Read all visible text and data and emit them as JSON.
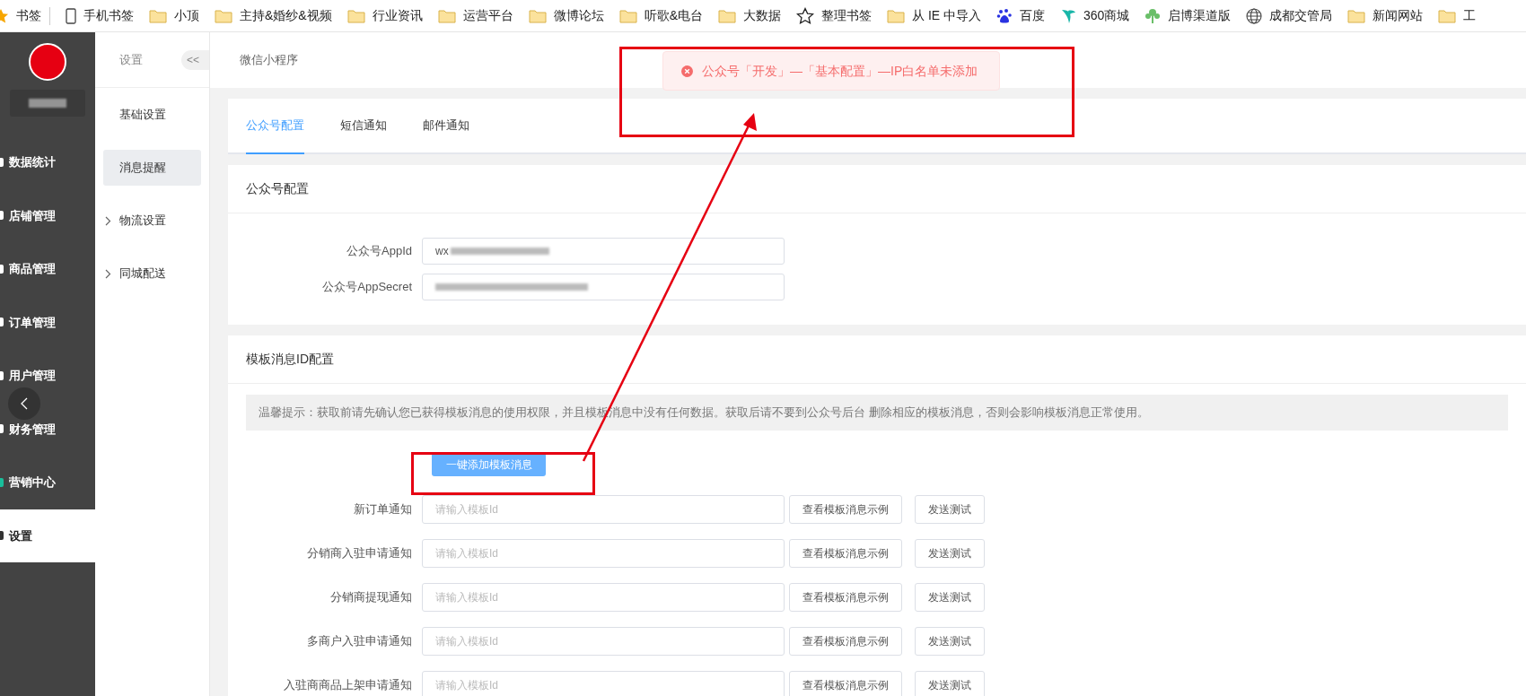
{
  "bookmarks": [
    {
      "kind": "star",
      "label": "书签"
    },
    {
      "kind": "phone",
      "label": "手机书签"
    },
    {
      "kind": "folder",
      "label": "小顶"
    },
    {
      "kind": "folder",
      "label": "主持&婚纱&视频"
    },
    {
      "kind": "folder",
      "label": "行业资讯"
    },
    {
      "kind": "folder",
      "label": "运营平台"
    },
    {
      "kind": "folder",
      "label": "微博论坛"
    },
    {
      "kind": "folder",
      "label": "听歌&电台"
    },
    {
      "kind": "folder",
      "label": "大数据"
    },
    {
      "kind": "manage",
      "label": "整理书签"
    },
    {
      "kind": "folder",
      "label": "从 IE 中导入"
    },
    {
      "kind": "paw",
      "label": "百度"
    },
    {
      "kind": "leaf",
      "label": "360商城"
    },
    {
      "kind": "tree",
      "label": "启博渠道版"
    },
    {
      "kind": "globe",
      "label": "成都交管局"
    },
    {
      "kind": "folder",
      "label": "新闻网站"
    },
    {
      "kind": "folder",
      "label": "工"
    }
  ],
  "main_menu": [
    {
      "label": "数据统计",
      "selected": false
    },
    {
      "label": "店铺管理",
      "selected": false
    },
    {
      "label": "商品管理",
      "selected": false
    },
    {
      "label": "订单管理",
      "selected": false
    },
    {
      "label": "用户管理",
      "selected": false
    },
    {
      "label": "财务管理",
      "selected": false
    },
    {
      "label": "营销中心",
      "selected": false,
      "color": "#19be9b"
    },
    {
      "label": "设置",
      "selected": true
    }
  ],
  "sub_sidebar": {
    "title": "设置",
    "collapse": "<<",
    "items": [
      {
        "label": "基础设置",
        "selected": false,
        "expandable": false
      },
      {
        "label": "消息提醒",
        "selected": true,
        "expandable": false
      },
      {
        "label": "物流设置",
        "selected": false,
        "expandable": true
      },
      {
        "label": "同城配送",
        "selected": false,
        "expandable": true
      }
    ]
  },
  "header": {
    "breadcrumb": "微信小程序"
  },
  "toast": {
    "message": "公众号「开发」—「基本配置」—IP白名单未添加"
  },
  "tabs": [
    {
      "label": "公众号配置",
      "selected": true
    },
    {
      "label": "短信通知",
      "selected": false
    },
    {
      "label": "邮件通知",
      "selected": false
    }
  ],
  "account_card": {
    "title": "公众号配置",
    "fields": [
      {
        "label": "公众号AppId",
        "value": "wx"
      },
      {
        "label": "公众号AppSecret"
      }
    ]
  },
  "template_card": {
    "title": "模板消息ID配置",
    "tip": "温馨提示：获取前请先确认您已获得模板消息的使用权限，并且模板消息中没有任何数据。获取后请不要到公众号后台 删除相应的模板消息，否则会影响模板消息正常使用。",
    "add_button": "一键添加模板消息",
    "rows": [
      {
        "label": "新订单通知",
        "placeholder": "请输入模板Id",
        "example_button": "查看模板消息示例",
        "test_button": "发送测试"
      },
      {
        "label": "分销商入驻申请通知",
        "placeholder": "请输入模板Id",
        "example_button": "查看模板消息示例",
        "test_button": "发送测试"
      },
      {
        "label": "分销商提现通知",
        "placeholder": "请输入模板Id",
        "example_button": "查看模板消息示例",
        "test_button": "发送测试"
      },
      {
        "label": "多商户入驻申请通知",
        "placeholder": "请输入模板Id",
        "example_button": "查看模板消息示例",
        "test_button": "发送测试"
      },
      {
        "label": "入驻商商品上架申请通知",
        "placeholder": "请输入模板Id",
        "example_button": "查看模板消息示例",
        "test_button": "发送测试"
      }
    ]
  }
}
